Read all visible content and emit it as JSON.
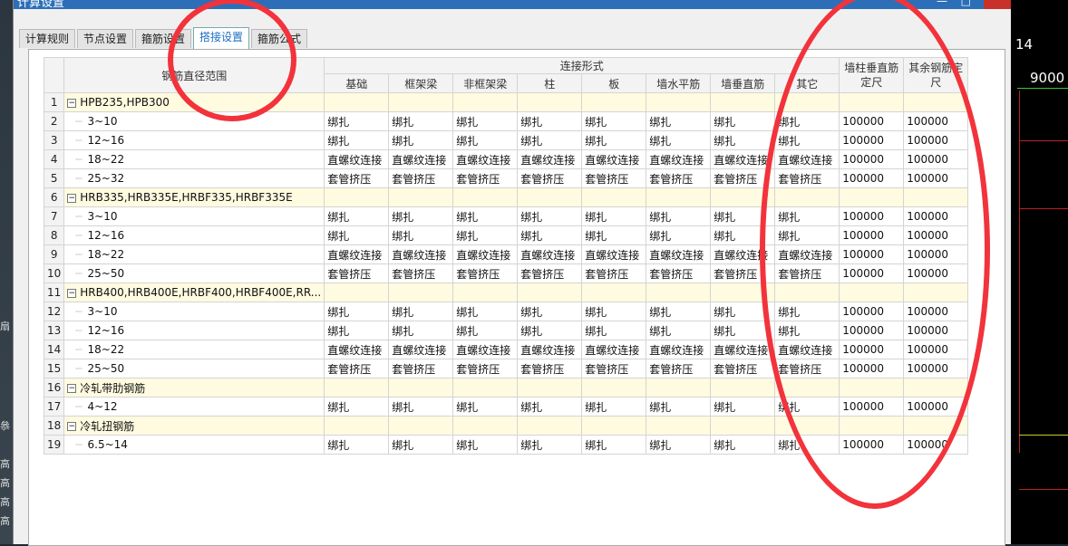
{
  "background": {
    "right_numbers": [
      "14",
      "9000"
    ],
    "left_chars": [
      "扇",
      "叅",
      "高",
      "高",
      "高",
      "高"
    ]
  },
  "window": {
    "title": "计算设置",
    "controls": [
      "—",
      "□",
      "×"
    ]
  },
  "tabs": [
    {
      "label": "计算规则",
      "active": false
    },
    {
      "label": "节点设置",
      "active": false
    },
    {
      "label": "箍筋设置",
      "active": false
    },
    {
      "label": "搭接设置",
      "active": true
    },
    {
      "label": "箍筋公式",
      "active": false
    }
  ],
  "table": {
    "header": {
      "range": "钢筋直径范围",
      "connection_group": "连接形式",
      "connection_cols": [
        "基础",
        "框架梁",
        "非框架梁",
        "柱",
        "板",
        "墙水平筋",
        "墙垂直筋",
        "其它"
      ],
      "col_wall": "墙柱垂直筋定尺",
      "col_other": "其余钢筋定尺"
    },
    "rows": [
      {
        "n": "1",
        "group": true,
        "name": "HPB235,HPB300"
      },
      {
        "n": "2",
        "name": "3~10",
        "cells": [
          "绑扎",
          "绑扎",
          "绑扎",
          "绑扎",
          "绑扎",
          "绑扎",
          "绑扎",
          "绑扎"
        ],
        "wall": "100000",
        "other": "100000"
      },
      {
        "n": "3",
        "name": "12~16",
        "cells": [
          "绑扎",
          "绑扎",
          "绑扎",
          "绑扎",
          "绑扎",
          "绑扎",
          "绑扎",
          "绑扎"
        ],
        "wall": "100000",
        "other": "100000"
      },
      {
        "n": "4",
        "name": "18~22",
        "cells": [
          "直螺纹连接",
          "直螺纹连接",
          "直螺纹连接",
          "直螺纹连接",
          "直螺纹连接",
          "直螺纹连接",
          "直螺纹连接",
          "直螺纹连接"
        ],
        "wall": "100000",
        "other": "100000"
      },
      {
        "n": "5",
        "name": "25~32",
        "cells": [
          "套管挤压",
          "套管挤压",
          "套管挤压",
          "套管挤压",
          "套管挤压",
          "套管挤压",
          "套管挤压",
          "套管挤压"
        ],
        "wall": "100000",
        "other": "100000"
      },
      {
        "n": "6",
        "group": true,
        "name": "HRB335,HRB335E,HRBF335,HRBF335E"
      },
      {
        "n": "7",
        "name": "3~10",
        "cells": [
          "绑扎",
          "绑扎",
          "绑扎",
          "绑扎",
          "绑扎",
          "绑扎",
          "绑扎",
          "绑扎"
        ],
        "wall": "100000",
        "other": "100000"
      },
      {
        "n": "8",
        "name": "12~16",
        "cells": [
          "绑扎",
          "绑扎",
          "绑扎",
          "绑扎",
          "绑扎",
          "绑扎",
          "绑扎",
          "绑扎"
        ],
        "wall": "100000",
        "other": "100000"
      },
      {
        "n": "9",
        "name": "18~22",
        "cells": [
          "直螺纹连接",
          "直螺纹连接",
          "直螺纹连接",
          "直螺纹连接",
          "直螺纹连接",
          "直螺纹连接",
          "直螺纹连接",
          "直螺纹连接"
        ],
        "wall": "100000",
        "other": "100000"
      },
      {
        "n": "10",
        "name": "25~50",
        "cells": [
          "套管挤压",
          "套管挤压",
          "套管挤压",
          "套管挤压",
          "套管挤压",
          "套管挤压",
          "套管挤压",
          "套管挤压"
        ],
        "wall": "100000",
        "other": "100000"
      },
      {
        "n": "11",
        "group": true,
        "name": "HRB400,HRB400E,HRBF400,HRBF400E,RR..."
      },
      {
        "n": "12",
        "name": "3~10",
        "cells": [
          "绑扎",
          "绑扎",
          "绑扎",
          "绑扎",
          "绑扎",
          "绑扎",
          "绑扎",
          "绑扎"
        ],
        "wall": "100000",
        "other": "100000"
      },
      {
        "n": "13",
        "name": "12~16",
        "cells": [
          "绑扎",
          "绑扎",
          "绑扎",
          "绑扎",
          "绑扎",
          "绑扎",
          "绑扎",
          "绑扎"
        ],
        "wall": "100000",
        "other": "100000"
      },
      {
        "n": "14",
        "name": "18~22",
        "cells": [
          "直螺纹连接",
          "直螺纹连接",
          "直螺纹连接",
          "直螺纹连接",
          "直螺纹连接",
          "直螺纹连接",
          "直螺纹连接",
          "直螺纹连接"
        ],
        "wall": "100000",
        "other": "100000"
      },
      {
        "n": "15",
        "name": "25~50",
        "cells": [
          "套管挤压",
          "套管挤压",
          "套管挤压",
          "套管挤压",
          "套管挤压",
          "套管挤压",
          "套管挤压",
          "套管挤压"
        ],
        "wall": "100000",
        "other": "100000"
      },
      {
        "n": "16",
        "group": true,
        "name": "冷轧带肋钢筋"
      },
      {
        "n": "17",
        "name": "4~12",
        "cells": [
          "绑扎",
          "绑扎",
          "绑扎",
          "绑扎",
          "绑扎",
          "绑扎",
          "绑扎",
          "绑扎"
        ],
        "wall": "100000",
        "other": "100000"
      },
      {
        "n": "18",
        "group": true,
        "name": "冷轧扭钢筋"
      },
      {
        "n": "19",
        "name": "6.5~14",
        "cells": [
          "绑扎",
          "绑扎",
          "绑扎",
          "绑扎",
          "绑扎",
          "绑扎",
          "绑扎",
          "绑扎"
        ],
        "wall": "100000",
        "other": "100000"
      }
    ]
  },
  "colors": {
    "annotation_red": "#f2333b",
    "group_row_bg": "#fffbe0",
    "active_tab_text": "#1d6fc2",
    "titlebar": "#2c6fb8"
  }
}
